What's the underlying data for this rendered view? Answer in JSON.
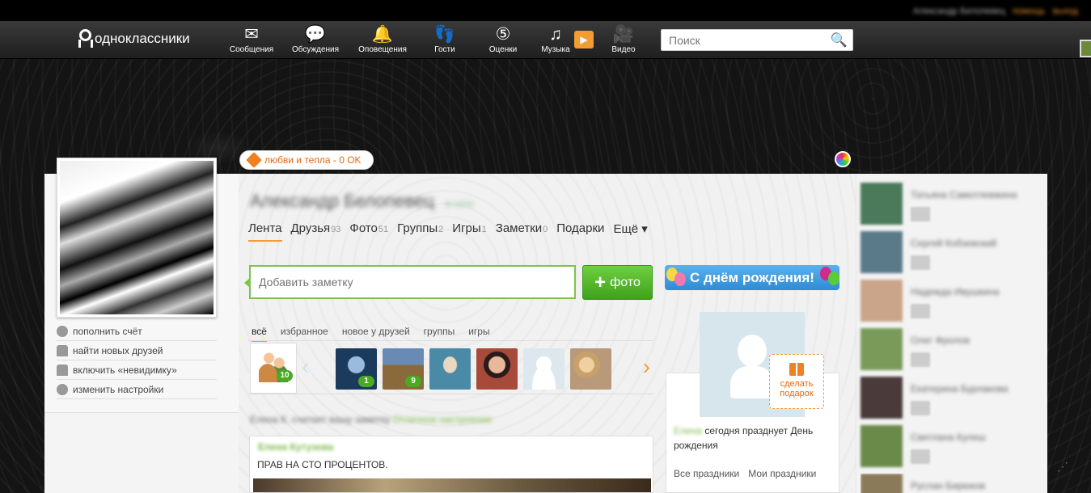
{
  "topbar": {
    "user_name": "Александр Белопевец",
    "link1": "помощь",
    "link2": "выход"
  },
  "header": {
    "logo_text": "одноклассники",
    "nav": [
      {
        "label": "Сообщения",
        "icon": "envelope-icon"
      },
      {
        "label": "Обсуждения",
        "icon": "chat-bubbles-icon"
      },
      {
        "label": "Оповещения",
        "icon": "bell-icon"
      },
      {
        "label": "Гости",
        "icon": "footprints-icon"
      },
      {
        "label": "Оценки",
        "icon": "rating-5-icon"
      },
      {
        "label": "Музыка",
        "icon": "music-note-icon"
      },
      {
        "label": "Видео",
        "icon": "video-camera-icon"
      }
    ],
    "search_placeholder": "Поиск"
  },
  "status": {
    "text": "любви и тепла - 0 OK"
  },
  "profile": {
    "name": "Александр Белопевец",
    "name_sub": "в сети",
    "tabs": [
      {
        "label": "Лента",
        "count": ""
      },
      {
        "label": "Друзья",
        "count": "93"
      },
      {
        "label": "Фото",
        "count": "51"
      },
      {
        "label": "Группы",
        "count": "2"
      },
      {
        "label": "Игры",
        "count": "1"
      },
      {
        "label": "Заметки",
        "count": "0"
      },
      {
        "label": "Подарки",
        "count": ""
      },
      {
        "label": "Ещё ▾",
        "count": ""
      }
    ]
  },
  "left_menu": [
    {
      "label": "пополнить счёт",
      "icon": "coins-icon"
    },
    {
      "label": "найти новых друзей",
      "icon": "person-icon"
    },
    {
      "label": "включить «невидимку»",
      "icon": "incognito-hat-icon"
    },
    {
      "label": "изменить настройки",
      "icon": "gear-icon"
    }
  ],
  "note": {
    "placeholder": "Добавить заметку"
  },
  "photo_button": {
    "label": "фото"
  },
  "birthday_banner": {
    "text": "С днём рождения!"
  },
  "feed_filters": [
    {
      "label": "всё",
      "active": true
    },
    {
      "label": "избранное",
      "active": false
    },
    {
      "label": "новое у друзей",
      "active": false
    },
    {
      "label": "группы",
      "active": false
    },
    {
      "label": "игры",
      "active": false
    }
  ],
  "friend_strip": {
    "group_badge": "10",
    "items": [
      {
        "badge": "1",
        "color": "#1b3a5c"
      },
      {
        "badge": "9",
        "color": "#8a6a3a"
      },
      {
        "badge": "",
        "color": "#4a8aa6"
      },
      {
        "badge": "",
        "color": "#a84a3a"
      },
      {
        "badge": "",
        "color": "#dde8ee"
      },
      {
        "badge": "",
        "color": "#b89a7a"
      }
    ]
  },
  "feed": {
    "summary": "Елена К. считает вашу заметку",
    "summary_link": "Отличное настроение",
    "post_author": "Елена Кутузова",
    "post_text": "ПРАВ НА СТО ПРОЦЕНТОВ."
  },
  "birthday": {
    "name": "Елена",
    "text": "сегодня празднует День рождения",
    "gift_label": "сделать подарок",
    "link_all": "Все праздники",
    "link_mine": "Мои праздники"
  },
  "right_friends": [
    {
      "name": "Татьяна Самотлевжина",
      "color": "#4a7a5a"
    },
    {
      "name": "Сергей Кобзевский",
      "color": "#5a7a8a"
    },
    {
      "name": "Надежда Ивушкина",
      "color": "#caa58a"
    },
    {
      "name": "Олег Фролов",
      "color": "#7a9a5a"
    },
    {
      "name": "Екатерина Бурлакова",
      "color": "#4a3a3a"
    },
    {
      "name": "Светлана Кулеш",
      "color": "#6a8a4a"
    },
    {
      "name": "Руслан Бирюков",
      "color": "#8a7a5a"
    }
  ]
}
